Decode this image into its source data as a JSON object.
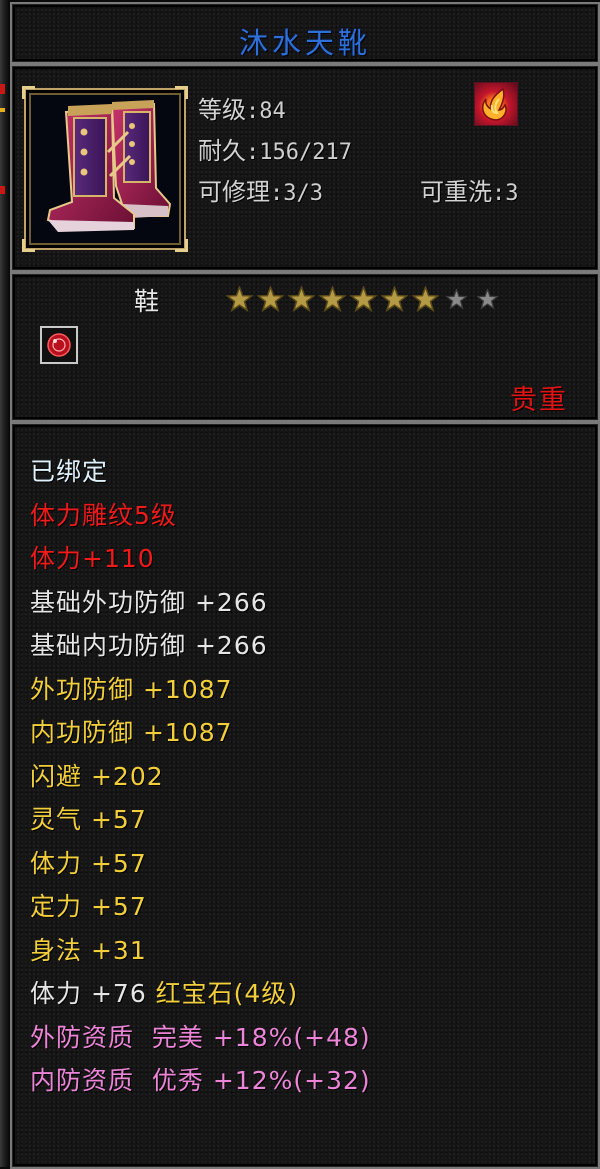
{
  "item": {
    "name": "沐水天靴",
    "level_label": "等级",
    "level_value": ":84",
    "durability_label": "耐久",
    "durability_value": ":156/217",
    "repair_label": "可修理",
    "repair_value": ":3/3",
    "rewash_label": "可重洗",
    "rewash_value": ":3",
    "type": "鞋",
    "stars_filled": 7,
    "stars_total": 9,
    "rarity": "贵重",
    "image_icon": "purple-boots-icon",
    "special_icon": "flame-emblem-icon",
    "gem_icon": "red-gem-socket-icon"
  },
  "attributes": [
    {
      "name": "已绑定",
      "value": "",
      "extra": "",
      "color": "#dff2fb"
    },
    {
      "name": "体力雕纹5级",
      "value": "",
      "extra": "",
      "color": "#ef1a1a"
    },
    {
      "name": "体力",
      "value": "+110",
      "extra": "",
      "color": "#ef1a1a"
    },
    {
      "name": "基础外功防御",
      "value": " +266",
      "extra": "",
      "color": "#e6e6e6"
    },
    {
      "name": "基础内功防御",
      "value": " +266",
      "extra": "",
      "color": "#e6e6e6"
    },
    {
      "name": "外功防御",
      "value": " +1087",
      "extra": "",
      "color": "#f2cf3a"
    },
    {
      "name": "内功防御",
      "value": " +1087",
      "extra": "",
      "color": "#f2cf3a"
    },
    {
      "name": "闪避",
      "value": " +202",
      "extra": "",
      "color": "#f2cf3a"
    },
    {
      "name": "灵气",
      "value": " +57",
      "extra": "",
      "color": "#f2cf3a"
    },
    {
      "name": "体力",
      "value": " +57",
      "extra": "",
      "color": "#f2cf3a"
    },
    {
      "name": "定力",
      "value": " +57",
      "extra": "",
      "color": "#f2cf3a"
    },
    {
      "name": "身法",
      "value": " +31",
      "extra": "",
      "color": "#f2cf3a"
    },
    {
      "name": "体力",
      "value": " +76",
      "extra": " 红宝石(4级)",
      "color": "#e6e6e6",
      "extra_color": "#f2cf3a"
    },
    {
      "name": "外防资质",
      "value": "  完美 +18%(+48)",
      "extra": "",
      "color": "#ec84d8"
    },
    {
      "name": "内防资质",
      "value": "  优秀 +12%(+32)",
      "extra": "",
      "color": "#ec84d8"
    }
  ],
  "colors": {
    "title": "#2f6fd8",
    "star_filled": "#b59a45",
    "star_empty": "#8a8a8a",
    "rarity": "#e11414"
  }
}
